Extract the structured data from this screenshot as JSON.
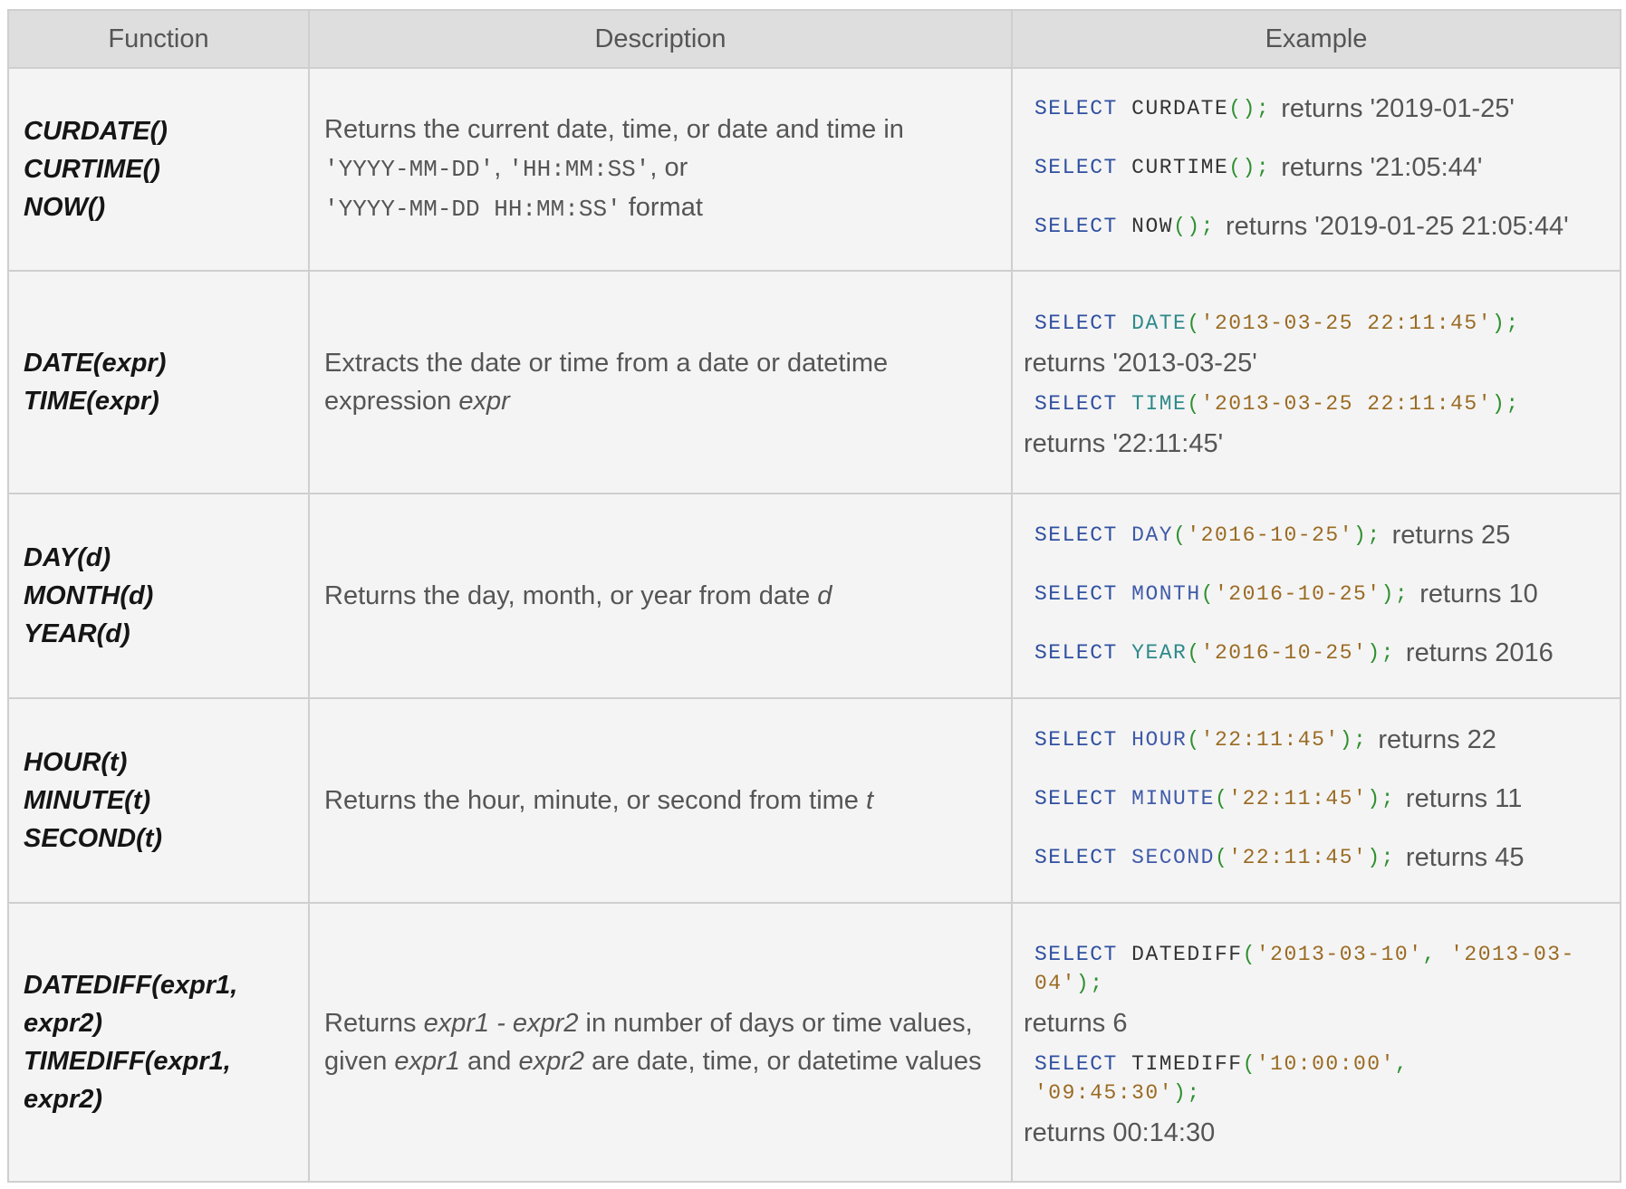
{
  "headers": [
    "Function",
    "Description",
    "Example"
  ],
  "rows": [
    {
      "functions": [
        "CURDATE()",
        "CURTIME()",
        "NOW()"
      ],
      "description": {
        "text1": "Returns the current date, time, or date and time in",
        "code1": "'YYYY-MM-DD'",
        "sep1": ",",
        "code2": "'HH:MM:SS'",
        "sep2": ", or",
        "code3": "'YYYY-MM-DD HH:MM:SS'",
        "text2": "format"
      },
      "examples": [
        {
          "kw": "SELECT",
          "fn": "CURDATE",
          "args": "",
          "end": "();",
          "ret": "returns '2019-01-25'"
        },
        {
          "kw": "SELECT",
          "fn": "CURTIME",
          "args": "",
          "end": "();",
          "ret": "returns '21:05:44'"
        },
        {
          "kw": "SELECT",
          "fn": "NOW",
          "args": "",
          "end": "();",
          "ret": "returns '2019-01-25 21:05:44'"
        }
      ]
    },
    {
      "functions": [
        "DATE(expr)",
        "TIME(expr)"
      ],
      "description": {
        "text1": "Extracts the date or time from a date or datetime expression",
        "italic": "expr"
      },
      "examples": [
        {
          "kw": "SELECT",
          "fn": "DATE",
          "open": "(",
          "arg": "'2013-03-25 22:11:45'",
          "close": ");",
          "ret": "returns '2013-03-25'"
        },
        {
          "kw": "SELECT",
          "fn": "TIME",
          "open": "(",
          "arg": "'2013-03-25 22:11:45'",
          "close": ");",
          "ret": "returns '22:11:45'"
        }
      ]
    },
    {
      "functions": [
        "DAY(d)",
        "MONTH(d)",
        "YEAR(d)"
      ],
      "description": {
        "text1": "Returns the day, month, or year from date",
        "italic": "d"
      },
      "examples": [
        {
          "kw": "SELECT",
          "fn": "DAY",
          "open": "(",
          "arg": "'2016-10-25'",
          "close": ");",
          "ret": "returns 25"
        },
        {
          "kw": "SELECT",
          "fn": "MONTH",
          "open": "(",
          "arg": "'2016-10-25'",
          "close": ");",
          "ret": "returns 10"
        },
        {
          "kw": "SELECT",
          "fn": "YEAR",
          "open": "(",
          "arg": "'2016-10-25'",
          "close": ");",
          "ret": "returns 2016"
        }
      ]
    },
    {
      "functions": [
        "HOUR(t)",
        "MINUTE(t)",
        "SECOND(t)"
      ],
      "description": {
        "text1": "Returns the hour, minute, or second from time",
        "italic": "t"
      },
      "examples": [
        {
          "kw": "SELECT",
          "fn": "HOUR",
          "open": "(",
          "arg": "'22:11:45'",
          "close": ");",
          "ret": "returns 22"
        },
        {
          "kw": "SELECT",
          "fn": "MINUTE",
          "open": "(",
          "arg": "'22:11:45'",
          "close": ");",
          "ret": "returns 11"
        },
        {
          "kw": "SELECT",
          "fn": "SECOND",
          "open": "(",
          "arg": "'22:11:45'",
          "close": ");",
          "ret": "returns 45"
        }
      ]
    },
    {
      "functions": [
        "DATEDIFF(expr1,",
        "expr2)",
        "TIMEDIFF(expr1,",
        "expr2)"
      ],
      "description": {
        "text1": "Returns",
        "i1": "expr1 - expr2",
        "text2": "in number of days or time values, given",
        "i2": "expr1",
        "text3": "and",
        "i3": "expr2",
        "text4": "are date, time, or datetime values"
      },
      "examples": [
        {
          "kw": "SELECT",
          "fn": "DATEDIFF",
          "open": "(",
          "arg1": "'2013-03-10'",
          "sep": ", ",
          "arg2a": "'2013-03-",
          "arg2b": "04'",
          "close": ");",
          "ret": "returns 6"
        },
        {
          "kw": "SELECT",
          "fn": "TIMEDIFF",
          "open": "(",
          "arg1": "'10:00:00'",
          "sep": ",",
          "arg2": "'09:45:30'",
          "close": ");",
          "ret": "returns 00:14:30"
        }
      ]
    }
  ]
}
